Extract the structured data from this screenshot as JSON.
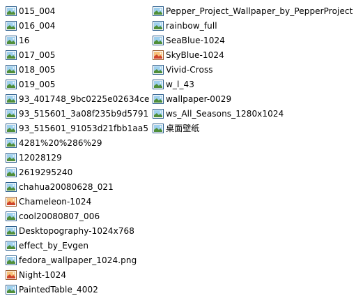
{
  "columns": [
    {
      "items": [
        {
          "name": "015_004",
          "icon": "jpeg-image-icon"
        },
        {
          "name": "016_004",
          "icon": "jpeg-image-icon"
        },
        {
          "name": "16",
          "icon": "jpeg-image-icon"
        },
        {
          "name": "017_005",
          "icon": "jpeg-image-icon"
        },
        {
          "name": "018_005",
          "icon": "jpeg-image-icon"
        },
        {
          "name": "019_005",
          "icon": "jpeg-image-icon"
        },
        {
          "name": "93_401748_9bc0225e02634ce",
          "icon": "jpeg-image-icon"
        },
        {
          "name": "93_515601_3a08f235b9d5791",
          "icon": "jpeg-image-icon"
        },
        {
          "name": "93_515601_91053d21fbb1aa5",
          "icon": "jpeg-image-icon"
        },
        {
          "name": "4281%20%286%29",
          "icon": "jpeg-image-icon"
        },
        {
          "name": "12028129",
          "icon": "jpeg-image-icon"
        },
        {
          "name": "2619295240",
          "icon": "jpeg-image-icon"
        },
        {
          "name": "chahua20080628_021",
          "icon": "jpeg-image-icon"
        },
        {
          "name": "Chameleon-1024",
          "icon": "png-image-icon"
        },
        {
          "name": "cool20080807_006",
          "icon": "jpeg-image-icon"
        },
        {
          "name": "Desktopography-1024x768",
          "icon": "jpeg-image-icon"
        },
        {
          "name": "effect_by_Evgen",
          "icon": "jpeg-image-icon"
        },
        {
          "name": "fedora_wallpaper_1024.png",
          "icon": "jpeg-image-icon"
        },
        {
          "name": "Night-1024",
          "icon": "png-image-icon"
        },
        {
          "name": "PaintedTable_4002",
          "icon": "jpeg-image-icon"
        }
      ]
    },
    {
      "items": [
        {
          "name": "Pepper_Project_Wallpaper_by_PepperProject",
          "icon": "jpeg-image-icon"
        },
        {
          "name": "rainbow_full",
          "icon": "jpeg-image-icon"
        },
        {
          "name": "SeaBlue-1024",
          "icon": "jpeg-image-icon"
        },
        {
          "name": "SkyBlue-1024",
          "icon": "png-image-icon"
        },
        {
          "name": "Vivid-Cross",
          "icon": "jpeg-image-icon"
        },
        {
          "name": "w_l_43",
          "icon": "jpeg-image-icon"
        },
        {
          "name": "wallpaper-0029",
          "icon": "jpeg-image-icon"
        },
        {
          "name": "ws_All_Seasons_1280x1024",
          "icon": "jpeg-image-icon"
        },
        {
          "name": "桌面壁纸",
          "icon": "jpeg-image-icon"
        }
      ]
    }
  ],
  "colors": {
    "jpeg_frame": "#2a5d8c",
    "jpeg_sky": "#9fd0ee",
    "jpeg_land": "#4f8f3a",
    "png_frame": "#9a5a2a",
    "png_sky": "#f6c27a",
    "png_land": "#d0452a"
  }
}
